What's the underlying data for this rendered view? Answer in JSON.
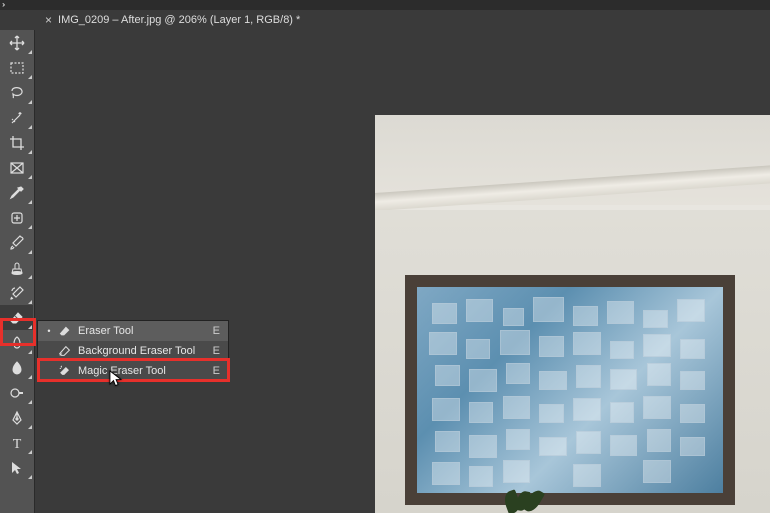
{
  "tab": {
    "title": "IMG_0209 – After.jpg @ 206% (Layer 1, RGB/8) *"
  },
  "tools": [
    {
      "name": "move-tool"
    },
    {
      "name": "marquee-tool"
    },
    {
      "name": "lasso-tool"
    },
    {
      "name": "magic-wand-tool"
    },
    {
      "name": "crop-tool"
    },
    {
      "name": "frame-tool"
    },
    {
      "name": "eyedropper-tool"
    },
    {
      "name": "healing-brush-tool"
    },
    {
      "name": "brush-tool"
    },
    {
      "name": "clone-stamp-tool"
    },
    {
      "name": "history-brush-tool"
    },
    {
      "name": "eraser-tool"
    },
    {
      "name": "gradient-tool"
    },
    {
      "name": "blur-tool"
    },
    {
      "name": "dodge-tool"
    },
    {
      "name": "pen-tool"
    },
    {
      "name": "type-tool"
    },
    {
      "name": "path-selection-tool"
    }
  ],
  "flyout": {
    "items": [
      {
        "label": "Eraser Tool",
        "shortcut": "E",
        "selected": true,
        "icon": "eraser-icon"
      },
      {
        "label": "Background Eraser Tool",
        "shortcut": "E",
        "selected": false,
        "icon": "bg-eraser-icon"
      },
      {
        "label": "Magic Eraser Tool",
        "shortcut": "E",
        "selected": false,
        "icon": "magic-eraser-icon"
      }
    ]
  }
}
